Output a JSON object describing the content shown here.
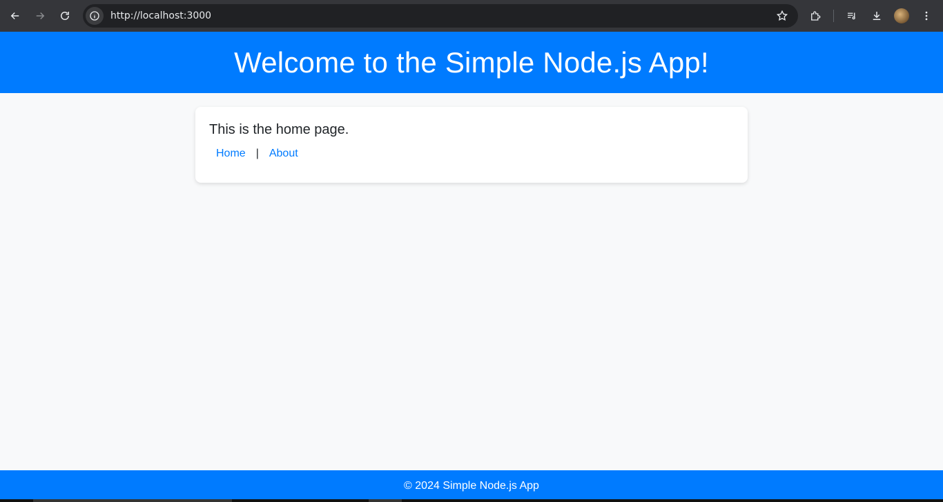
{
  "browser": {
    "url": "http://localhost:3000"
  },
  "page": {
    "header_title": "Welcome to the Simple Node.js App!",
    "content_text": "This is the home page.",
    "nav": {
      "home_label": "Home",
      "separator": "|",
      "about_label": "About"
    },
    "footer_text": "© 2024 Simple Node.js App"
  },
  "colors": {
    "brand_blue": "#007bff",
    "chrome_bg": "#35363a",
    "page_bg": "#f8f9fa"
  },
  "icons": [
    "back-arrow-icon",
    "forward-arrow-icon",
    "reload-icon",
    "site-info-icon",
    "star-icon",
    "extensions-icon",
    "media-control-icon",
    "download-icon",
    "profile-avatar",
    "kebab-menu-icon"
  ]
}
